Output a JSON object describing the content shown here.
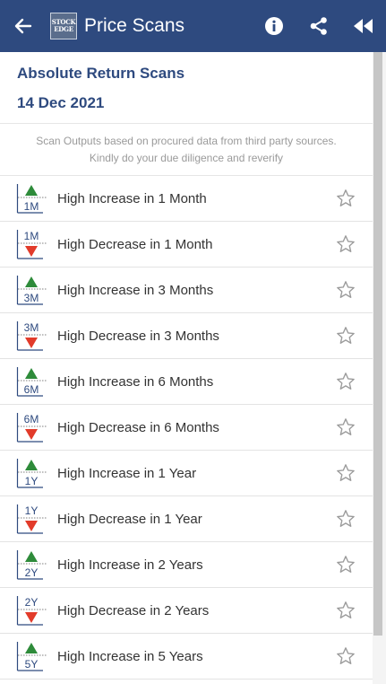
{
  "appbar": {
    "title": "Price Scans",
    "logo_lines": [
      "STOCK",
      "EDGE"
    ],
    "icons": [
      "back-arrow-icon",
      "info-icon",
      "share-icon",
      "rewind-icon"
    ],
    "background": "#2e4a7f"
  },
  "header": {
    "title": "Absolute Return Scans",
    "date": "14 Dec 2021"
  },
  "disclaimer": {
    "line1": "Scan Outputs based on procured data from third party sources.",
    "line2": "Kindly do your due diligence and reverify"
  },
  "colors": {
    "increase": "#2e8b3a",
    "decrease": "#e23b2a",
    "accent": "#2e4a7f"
  },
  "scans": [
    {
      "label": "High Increase in 1 Month",
      "period": "1M",
      "direction": "up",
      "favorite": false
    },
    {
      "label": "High Decrease in 1 Month",
      "period": "1M",
      "direction": "down",
      "favorite": false
    },
    {
      "label": "High Increase in 3 Months",
      "period": "3M",
      "direction": "up",
      "favorite": false
    },
    {
      "label": "High Decrease in 3 Months",
      "period": "3M",
      "direction": "down",
      "favorite": false
    },
    {
      "label": "High Increase in 6 Months",
      "period": "6M",
      "direction": "up",
      "favorite": false
    },
    {
      "label": "High Decrease in 6 Months",
      "period": "6M",
      "direction": "down",
      "favorite": false
    },
    {
      "label": "High Increase in 1 Year",
      "period": "1Y",
      "direction": "up",
      "favorite": false
    },
    {
      "label": "High Decrease in 1 Year",
      "period": "1Y",
      "direction": "down",
      "favorite": false
    },
    {
      "label": "High Increase in 2 Years",
      "period": "2Y",
      "direction": "up",
      "favorite": false
    },
    {
      "label": "High Decrease in 2 Years",
      "period": "2Y",
      "direction": "down",
      "favorite": false
    },
    {
      "label": "High Increase in 5 Years",
      "period": "5Y",
      "direction": "up",
      "favorite": false
    }
  ]
}
